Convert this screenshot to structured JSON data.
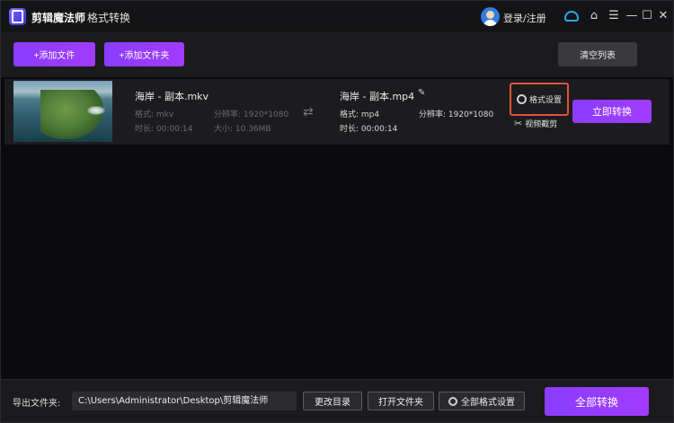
{
  "titlebar": {
    "app_name": "剪辑魔法师",
    "separator": "-",
    "subtitle": "格式转换",
    "login_label": "登录/注册",
    "icons": [
      "support-icon",
      "home-icon",
      "menu-icon",
      "minimize-icon",
      "maximize-icon",
      "close-icon"
    ]
  },
  "toolbar": {
    "add_file_label": "+添加文件",
    "add_folder_label": "+添加文件夹",
    "clear_list_label": "清空列表"
  },
  "file": {
    "source": {
      "name": "海岸 - 副本.mkv",
      "format": "格式: mkv",
      "resolution": "分辨率: 1920*1080",
      "duration": "时长: 00:00:14",
      "size": "大小: 10.36MB"
    },
    "target": {
      "name": "海岸 - 副本.mp4",
      "format": "格式: mp4",
      "resolution": "分辨率: 1920*1080",
      "duration": "时长: 00:00:14"
    },
    "format_settings_label": "格式设置",
    "trim_label": "视频截剪",
    "convert_now_label": "立即转换"
  },
  "bottom": {
    "output_label": "导出文件夹:",
    "output_path": "C:\\Users\\Administrator\\Desktop\\剪辑魔法师",
    "change_dir_label": "更改目录",
    "open_folder_label": "打开文件夹",
    "all_format_label": "全部格式设置",
    "convert_all_label": "全部转换"
  },
  "colors": {
    "accent_purple": "#9a3cff",
    "highlight_border": "#e0523d",
    "avatar_blue": "#2f7de1"
  }
}
